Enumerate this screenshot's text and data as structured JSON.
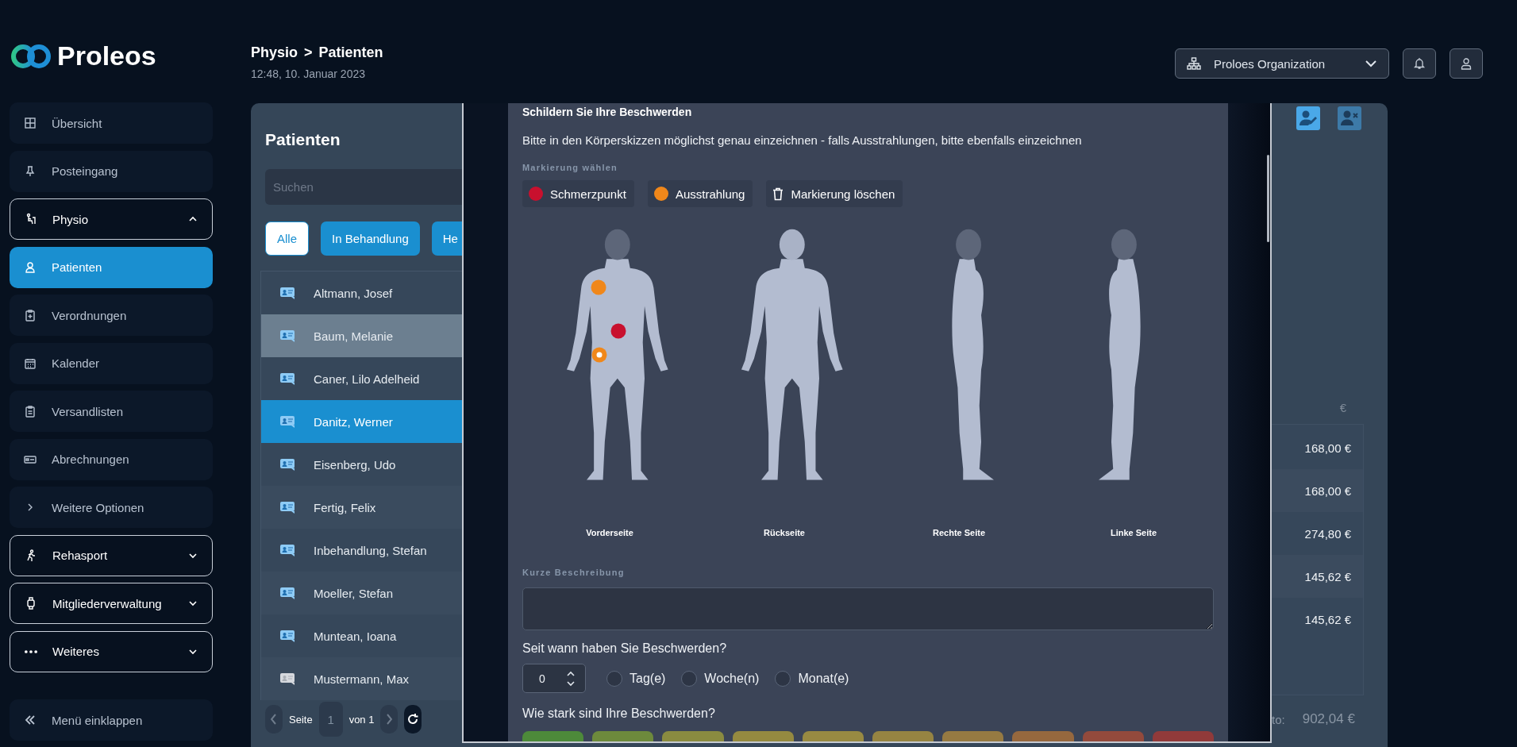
{
  "sidebar": {
    "logo": "Proleos",
    "items": [
      {
        "kind": "link",
        "label": "Übersicht",
        "selected": false
      },
      {
        "kind": "link",
        "label": "Posteingang",
        "selected": false
      },
      {
        "kind": "group",
        "label": "Physio",
        "selected": false,
        "expanded": true
      },
      {
        "kind": "link",
        "label": "Patienten",
        "selected": true
      },
      {
        "kind": "link",
        "label": "Verordnungen",
        "selected": false
      },
      {
        "kind": "link",
        "label": "Kalender",
        "selected": false
      },
      {
        "kind": "link",
        "label": "Versandlisten",
        "selected": false
      },
      {
        "kind": "link",
        "label": "Abrechnungen",
        "selected": false
      },
      {
        "kind": "link",
        "label": "Weitere Optionen",
        "selected": false
      },
      {
        "kind": "group",
        "label": "Rehasport",
        "selected": false,
        "expanded": false
      },
      {
        "kind": "group",
        "label": "Mitgliederverwaltung",
        "selected": false,
        "expanded": false
      },
      {
        "kind": "group",
        "label": "Weiteres",
        "selected": false,
        "expanded": false
      }
    ],
    "collapse": "Menü einklappen"
  },
  "header": {
    "breadcrumb": [
      "Physio",
      "Patienten"
    ],
    "separator": ">",
    "timestamp": "12:48, 10. Januar 2023",
    "organization": "Proloes Organization"
  },
  "patients": {
    "title": "Patienten",
    "search": {
      "placeholder": "Suchen"
    },
    "filters": [
      {
        "label": "Alle",
        "selected": true
      },
      {
        "label": "In Behandlung",
        "selected": false
      },
      {
        "label": "He",
        "selected": false
      }
    ],
    "rows": [
      {
        "name": "Altmann, Josef",
        "card_active": true,
        "hovered": false,
        "selected": false
      },
      {
        "name": "Baum, Melanie",
        "card_active": true,
        "hovered": true,
        "selected": false
      },
      {
        "name": "Caner, Lilo Adelheid",
        "card_active": true,
        "hovered": false,
        "selected": false
      },
      {
        "name": "Danitz, Werner",
        "card_active": true,
        "hovered": false,
        "selected": true
      },
      {
        "name": "Eisenberg, Udo",
        "card_active": true,
        "hovered": false,
        "selected": false
      },
      {
        "name": "Fertig, Felix",
        "card_active": true,
        "hovered": false,
        "selected": false
      },
      {
        "name": "Inbehandlung, Stefan",
        "card_active": true,
        "hovered": false,
        "selected": false
      },
      {
        "name": "Moeller, Stefan",
        "card_active": true,
        "hovered": false,
        "selected": false
      },
      {
        "name": "Muntean, Ioana",
        "card_active": true,
        "hovered": false,
        "selected": false
      },
      {
        "name": "Mustermann, Max",
        "card_active": false,
        "hovered": false,
        "selected": false
      }
    ],
    "pagination": {
      "page_label": "Seite",
      "page": "1",
      "of_label": "von 1"
    }
  },
  "complaint_form": {
    "title": "Schildern Sie Ihre Beschwerden",
    "instruction": "Bitte in den Körperskizzen möglichst genau einzeichnen - falls Ausstrahlungen, bitte ebenfalls einzeichnen",
    "marker_label": "Markierung wählen",
    "marker_options": [
      {
        "kind": "pain",
        "label": "Schmerzpunkt",
        "color": "#c8102e"
      },
      {
        "kind": "radiation",
        "label": "Ausstrahlung",
        "color": "#f0871a"
      },
      {
        "kind": "clear",
        "label": "Markierung löschen"
      }
    ],
    "views": [
      {
        "kind": "front",
        "label": "Vorderseite",
        "markers": [
          {
            "kind": "radiation",
            "selected": false
          },
          {
            "kind": "pain",
            "selected": false
          },
          {
            "kind": "radiation",
            "selected": true
          }
        ]
      },
      {
        "kind": "back",
        "label": "Rückseite"
      },
      {
        "kind": "right",
        "label": "Rechte Seite"
      },
      {
        "kind": "left",
        "label": "Linke Seite"
      }
    ],
    "description_label": "Kurze Beschreibung",
    "since_question": "Seit wann haben Sie Beschwerden?",
    "since_value": "0",
    "since_units": [
      {
        "label": "Tag(e)",
        "selected": false
      },
      {
        "label": "Woche(n)",
        "selected": false
      },
      {
        "label": "Monat(e)",
        "selected": false
      }
    ],
    "severity_question": "Wie stark sind Ihre Beschwerden?",
    "severity_scale": [
      {
        "color": "#4d8a3a"
      },
      {
        "color": "#6d8a3c"
      },
      {
        "color": "#8a8b40"
      },
      {
        "color": "#958a40"
      },
      {
        "color": "#988a42"
      },
      {
        "color": "#968442"
      },
      {
        "color": "#967a42"
      },
      {
        "color": "#96683e"
      },
      {
        "color": "#934a3c"
      },
      {
        "color": "#913a3a"
      }
    ]
  },
  "details": {
    "amount_header": "€",
    "amounts": [
      "168,00 €",
      "168,00 €",
      "274,80 €",
      "145,62 €",
      "145,62 €"
    ],
    "total_label": "to:",
    "total": "902,04 €"
  }
}
